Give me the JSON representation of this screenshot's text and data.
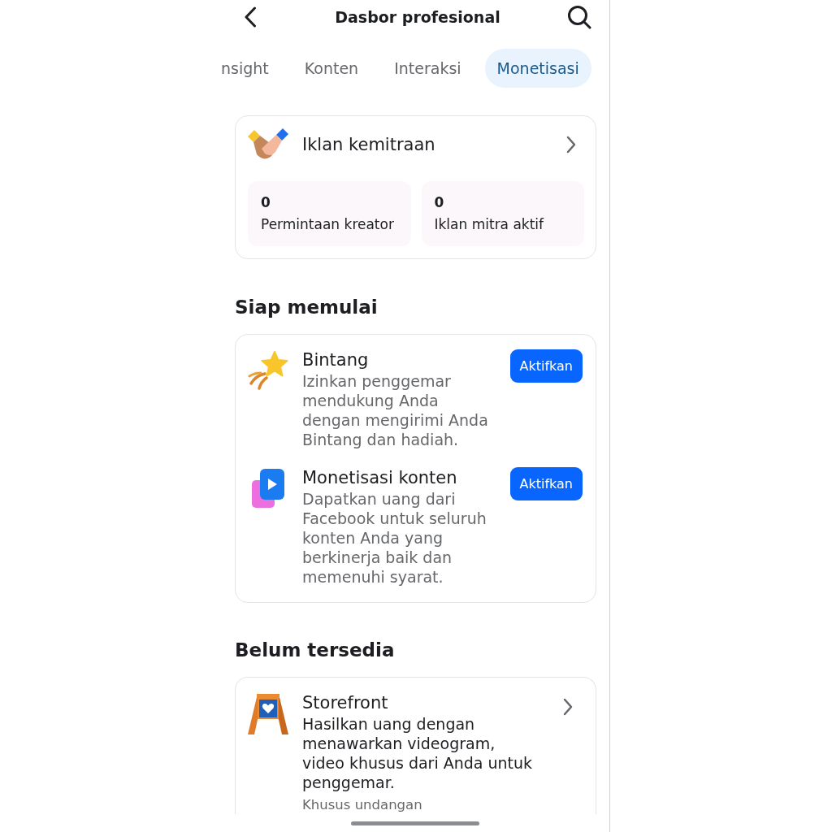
{
  "header": {
    "title": "Dasbor profesional"
  },
  "tabs": [
    {
      "label": "nsight",
      "selected": false
    },
    {
      "label": "Konten",
      "selected": false
    },
    {
      "label": "Interaksi",
      "selected": false
    },
    {
      "label": "Monetisasi",
      "selected": true
    }
  ],
  "partner_ads": {
    "title": "Iklan kemitraan",
    "stats": [
      {
        "value": "0",
        "label": "Permintaan kreator"
      },
      {
        "value": "0",
        "label": "Iklan mitra aktif"
      }
    ]
  },
  "sections": [
    {
      "heading": "Siap memulai",
      "items": [
        {
          "kind": "action",
          "title": "Bintang",
          "description": "Izinkan penggemar mendukung Anda dengan mengirimi Anda Bintang dan hadiah.",
          "button": "Aktifkan"
        },
        {
          "kind": "action",
          "title": "Monetisasi konten",
          "description": "Dapatkan uang dari Facebook untuk seluruh konten Anda yang berkinerja baik dan memenuhi syarat.",
          "button": "Aktifkan"
        }
      ]
    },
    {
      "heading": "Belum tersedia",
      "items": [
        {
          "kind": "link",
          "title": "Storefront",
          "description": "Hasilkan uang dengan menawarkan videogram, video khusus dari Anda untuk penggemar.",
          "note": "Khusus undangan"
        }
      ]
    }
  ]
}
